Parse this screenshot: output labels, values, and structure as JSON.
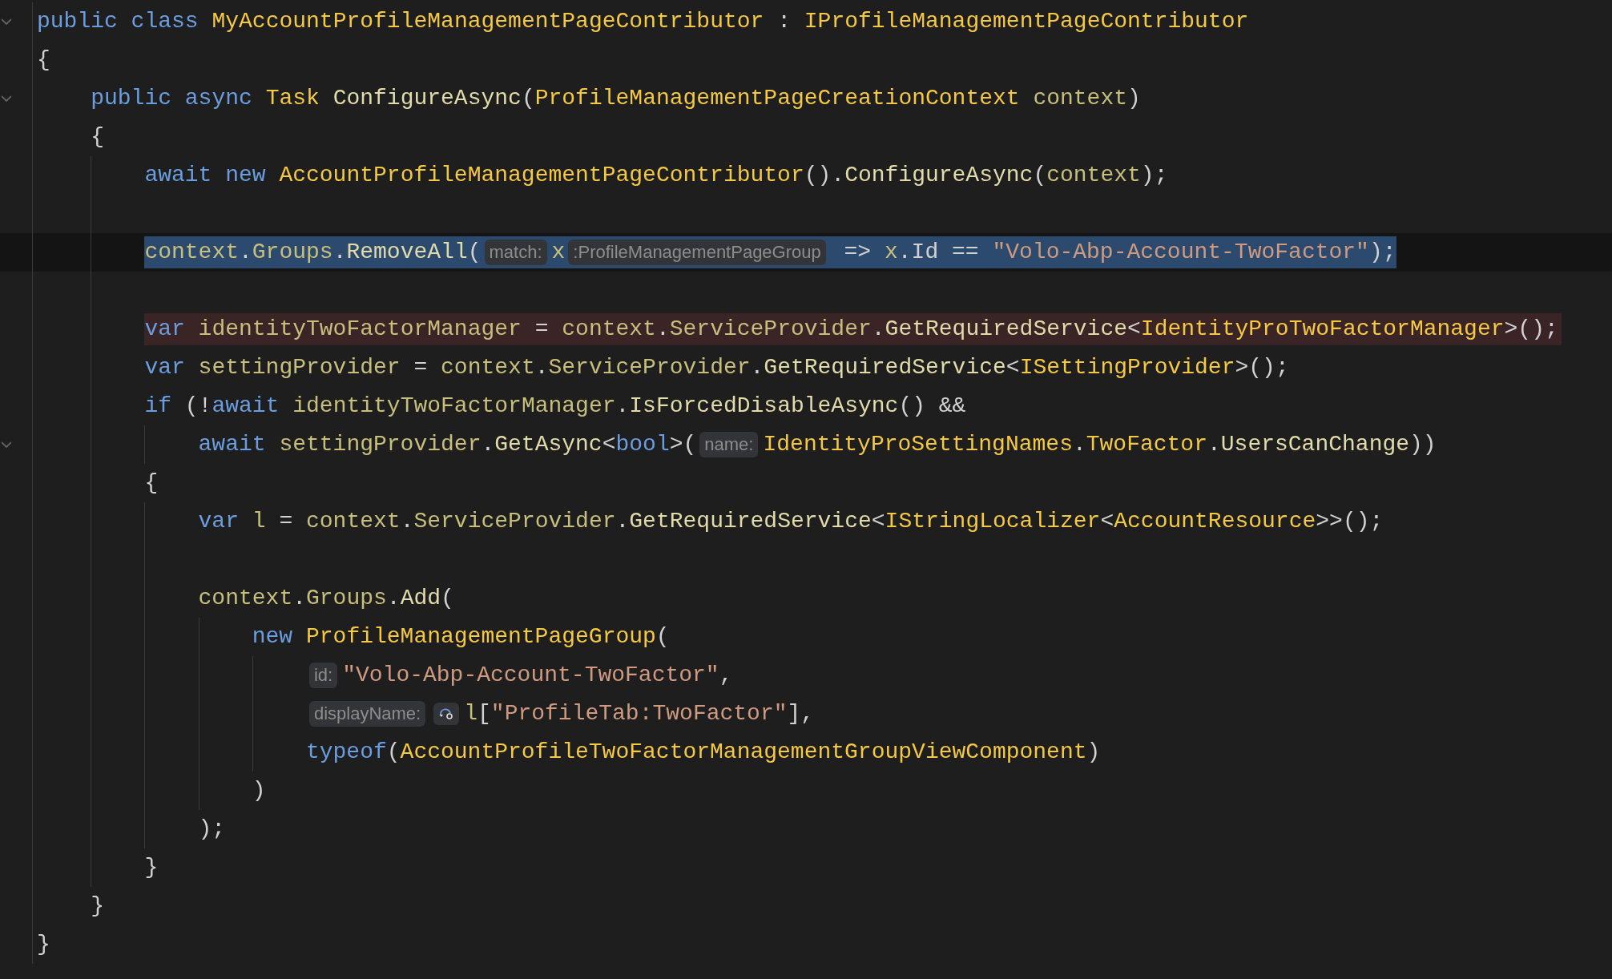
{
  "lines": [
    {
      "fold": true,
      "selected": false,
      "flagged": false,
      "tokens": [
        {
          "kind": "keyword",
          "text": "public class "
        },
        {
          "kind": "type",
          "text": "MyAccountProfileManagementPageContributor"
        },
        {
          "kind": "plain",
          "text": " : "
        },
        {
          "kind": "type",
          "text": "IProfileManagementPageContributor"
        }
      ]
    },
    {
      "fold": false,
      "selected": false,
      "flagged": false,
      "tokens": [
        {
          "kind": "plain",
          "text": "{"
        }
      ],
      "children": [
        {
          "fold": true,
          "selected": false,
          "flagged": false,
          "tokens": [
            {
              "kind": "keyword",
              "text": "public async "
            },
            {
              "kind": "type",
              "text": "Task "
            },
            {
              "kind": "method",
              "text": "ConfigureAsync"
            },
            {
              "kind": "plain",
              "text": "("
            },
            {
              "kind": "type",
              "text": "ProfileManagementPageCreationContext "
            },
            {
              "kind": "member",
              "text": "context"
            },
            {
              "kind": "plain",
              "text": ")"
            }
          ]
        },
        {
          "fold": false,
          "selected": false,
          "flagged": false,
          "tokens": [
            {
              "kind": "plain",
              "text": "{"
            }
          ],
          "children": [
            {
              "fold": false,
              "selected": false,
              "flagged": false,
              "tokens": [
                {
                  "kind": "keyword",
                  "text": "await new "
                },
                {
                  "kind": "type",
                  "text": "AccountProfileManagementPageContributor"
                },
                {
                  "kind": "plain",
                  "text": "()."
                },
                {
                  "kind": "method",
                  "text": "ConfigureAsync"
                },
                {
                  "kind": "plain",
                  "text": "("
                },
                {
                  "kind": "member",
                  "text": "context"
                },
                {
                  "kind": "plain",
                  "text": ");"
                }
              ]
            },
            {
              "fold": false,
              "selected": false,
              "flagged": false
            },
            {
              "fold": false,
              "selected": true,
              "flagged": false,
              "tokens": [
                {
                  "kind": "member",
                  "text": "context"
                },
                {
                  "kind": "plain",
                  "text": "."
                },
                {
                  "kind": "member",
                  "text": "Groups"
                },
                {
                  "kind": "plain",
                  "text": "."
                },
                {
                  "kind": "method",
                  "text": "RemoveAll"
                },
                {
                  "kind": "plain",
                  "text": "("
                },
                {
                  "kind": "hint",
                  "text": "match:"
                },
                {
                  "kind": "member",
                  "text": "x"
                },
                {
                  "kind": "hint",
                  "text": ":ProfileManagementPageGroup"
                },
                {
                  "kind": "plain",
                  "text": " => "
                },
                {
                  "kind": "member",
                  "text": "x"
                },
                {
                  "kind": "plain",
                  "text": ".Id == "
                },
                {
                  "kind": "string",
                  "text": "\"Volo-Abp-Account-TwoFactor\""
                },
                {
                  "kind": "plain",
                  "text": ");"
                }
              ]
            },
            {
              "fold": false,
              "selected": false,
              "flagged": false
            },
            {
              "fold": false,
              "selected": false,
              "flagged": true,
              "tokens": [
                {
                  "kind": "keyword",
                  "text": "var "
                },
                {
                  "kind": "member",
                  "text": "identityTwoFactorManager"
                },
                {
                  "kind": "plain",
                  "text": " = "
                },
                {
                  "kind": "member",
                  "text": "context"
                },
                {
                  "kind": "plain",
                  "text": "."
                },
                {
                  "kind": "member",
                  "text": "ServiceProvider"
                },
                {
                  "kind": "plain",
                  "text": "."
                },
                {
                  "kind": "method",
                  "text": "GetRequiredService"
                },
                {
                  "kind": "plain",
                  "text": "<"
                },
                {
                  "kind": "type",
                  "text": "IdentityProTwoFactorManager"
                },
                {
                  "kind": "plain",
                  "text": ">();"
                }
              ]
            },
            {
              "fold": false,
              "selected": false,
              "flagged": false,
              "tokens": [
                {
                  "kind": "keyword",
                  "text": "var "
                },
                {
                  "kind": "member",
                  "text": "settingProvider"
                },
                {
                  "kind": "plain",
                  "text": " = "
                },
                {
                  "kind": "member",
                  "text": "context"
                },
                {
                  "kind": "plain",
                  "text": "."
                },
                {
                  "kind": "member",
                  "text": "ServiceProvider"
                },
                {
                  "kind": "plain",
                  "text": "."
                },
                {
                  "kind": "method",
                  "text": "GetRequiredService"
                },
                {
                  "kind": "plain",
                  "text": "<"
                },
                {
                  "kind": "type",
                  "text": "ISettingProvider"
                },
                {
                  "kind": "plain",
                  "text": ">();"
                }
              ]
            },
            {
              "fold": false,
              "selected": false,
              "flagged": false,
              "tokens": [
                {
                  "kind": "keyword",
                  "text": "if "
                },
                {
                  "kind": "plain",
                  "text": "(!"
                },
                {
                  "kind": "keyword",
                  "text": "await "
                },
                {
                  "kind": "member",
                  "text": "identityTwoFactorManager"
                },
                {
                  "kind": "plain",
                  "text": "."
                },
                {
                  "kind": "method",
                  "text": "IsForcedDisableAsync"
                },
                {
                  "kind": "plain",
                  "text": "() &&"
                }
              ],
              "children": [
                {
                  "fold": true,
                  "selected": false,
                  "flagged": false,
                  "tokens": [
                    {
                      "kind": "keyword",
                      "text": "await "
                    },
                    {
                      "kind": "member",
                      "text": "settingProvider"
                    },
                    {
                      "kind": "plain",
                      "text": "."
                    },
                    {
                      "kind": "method",
                      "text": "GetAsync"
                    },
                    {
                      "kind": "plain",
                      "text": "<"
                    },
                    {
                      "kind": "keyword",
                      "text": "bool"
                    },
                    {
                      "kind": "plain",
                      "text": ">("
                    },
                    {
                      "kind": "hint",
                      "text": "name:"
                    },
                    {
                      "kind": "type",
                      "text": "IdentityProSettingNames"
                    },
                    {
                      "kind": "plain",
                      "text": "."
                    },
                    {
                      "kind": "type",
                      "text": "TwoFactor"
                    },
                    {
                      "kind": "plain",
                      "text": "."
                    },
                    {
                      "kind": "method",
                      "text": "UsersCanChange"
                    },
                    {
                      "kind": "plain",
                      "text": "))"
                    }
                  ]
                }
              ]
            },
            {
              "fold": false,
              "selected": false,
              "flagged": false,
              "tokens": [
                {
                  "kind": "plain",
                  "text": "{"
                }
              ],
              "children": [
                {
                  "fold": false,
                  "selected": false,
                  "flagged": false,
                  "tokens": [
                    {
                      "kind": "keyword",
                      "text": "var "
                    },
                    {
                      "kind": "member",
                      "text": "l"
                    },
                    {
                      "kind": "plain",
                      "text": " = "
                    },
                    {
                      "kind": "member",
                      "text": "context"
                    },
                    {
                      "kind": "plain",
                      "text": "."
                    },
                    {
                      "kind": "member",
                      "text": "ServiceProvider"
                    },
                    {
                      "kind": "plain",
                      "text": "."
                    },
                    {
                      "kind": "method",
                      "text": "GetRequiredService"
                    },
                    {
                      "kind": "plain",
                      "text": "<"
                    },
                    {
                      "kind": "type",
                      "text": "IStringLocalizer"
                    },
                    {
                      "kind": "plain",
                      "text": "<"
                    },
                    {
                      "kind": "type",
                      "text": "AccountResource"
                    },
                    {
                      "kind": "plain",
                      "text": ">>();"
                    }
                  ]
                },
                {
                  "fold": false,
                  "selected": false,
                  "flagged": false
                },
                {
                  "fold": false,
                  "selected": false,
                  "flagged": false,
                  "tokens": [
                    {
                      "kind": "member",
                      "text": "context"
                    },
                    {
                      "kind": "plain",
                      "text": "."
                    },
                    {
                      "kind": "member",
                      "text": "Groups"
                    },
                    {
                      "kind": "plain",
                      "text": "."
                    },
                    {
                      "kind": "method",
                      "text": "Add"
                    },
                    {
                      "kind": "plain",
                      "text": "("
                    }
                  ],
                  "children": [
                    {
                      "fold": false,
                      "selected": false,
                      "flagged": false,
                      "tokens": [
                        {
                          "kind": "keyword",
                          "text": "new "
                        },
                        {
                          "kind": "type",
                          "text": "ProfileManagementPageGroup"
                        },
                        {
                          "kind": "plain",
                          "text": "("
                        }
                      ],
                      "children": [
                        {
                          "fold": false,
                          "selected": false,
                          "flagged": false,
                          "tokens": [
                            {
                              "kind": "hint",
                              "text": "id:"
                            },
                            {
                              "kind": "string",
                              "text": "\"Volo-Abp-Account-TwoFactor\""
                            },
                            {
                              "kind": "plain",
                              "text": ","
                            }
                          ]
                        },
                        {
                          "fold": false,
                          "selected": false,
                          "flagged": false,
                          "tokens": [
                            {
                              "kind": "hint",
                              "text": "displayName:"
                            },
                            {
                              "kind": "icon"
                            },
                            {
                              "kind": "member",
                              "text": "l"
                            },
                            {
                              "kind": "plain",
                              "text": "["
                            },
                            {
                              "kind": "string",
                              "text": "\"ProfileTab:TwoFactor\""
                            },
                            {
                              "kind": "plain",
                              "text": "],"
                            }
                          ]
                        },
                        {
                          "fold": false,
                          "selected": false,
                          "flagged": false,
                          "tokens": [
                            {
                              "kind": "keyword",
                              "text": "typeof"
                            },
                            {
                              "kind": "plain",
                              "text": "("
                            },
                            {
                              "kind": "type",
                              "text": "AccountProfileTwoFactorManagementGroupViewComponent"
                            },
                            {
                              "kind": "plain",
                              "text": ")"
                            }
                          ]
                        }
                      ]
                    },
                    {
                      "fold": false,
                      "selected": false,
                      "flagged": false,
                      "tokens": [
                        {
                          "kind": "plain",
                          "text": ")"
                        }
                      ]
                    }
                  ]
                },
                {
                  "fold": false,
                  "selected": false,
                  "flagged": false,
                  "tokens": [
                    {
                      "kind": "plain",
                      "text": ");"
                    }
                  ]
                }
              ]
            },
            {
              "fold": false,
              "selected": false,
              "flagged": false,
              "tokens": [
                {
                  "kind": "plain",
                  "text": "}"
                }
              ]
            }
          ]
        },
        {
          "fold": false,
          "selected": false,
          "flagged": false,
          "tokens": [
            {
              "kind": "plain",
              "text": "}"
            }
          ]
        }
      ]
    },
    {
      "fold": false,
      "selected": false,
      "flagged": false,
      "tokens": [
        {
          "kind": "plain",
          "text": "}"
        }
      ]
    }
  ]
}
